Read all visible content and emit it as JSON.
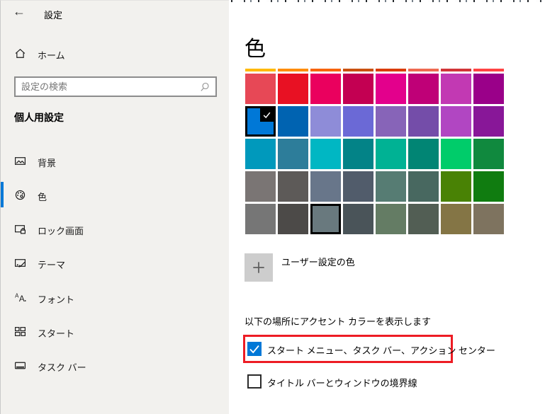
{
  "window": {
    "title": "設定",
    "back_icon": "←"
  },
  "sidebar": {
    "home": {
      "label": "ホーム",
      "icon": "home-icon"
    },
    "search": {
      "placeholder": "設定の検索",
      "icon": "search-icon"
    },
    "section_title": "個人用設定",
    "items": [
      {
        "label": "背景",
        "icon": "picture-icon",
        "selected": false
      },
      {
        "label": "色",
        "icon": "palette-icon",
        "selected": true
      },
      {
        "label": "ロック画面",
        "icon": "lock-screen-icon",
        "selected": false
      },
      {
        "label": "テーマ",
        "icon": "theme-icon",
        "selected": false
      },
      {
        "label": "フォント",
        "icon": "fonts-icon",
        "selected": false
      },
      {
        "label": "スタート",
        "icon": "start-tiles-icon",
        "selected": false
      },
      {
        "label": "タスク バー",
        "icon": "taskbar-icon",
        "selected": false
      }
    ]
  },
  "main": {
    "page_title": "色",
    "palette": {
      "colors": [
        "#ffb900",
        "#ff8c00",
        "#f7630c",
        "#ca5010",
        "#da3b01",
        "#ef6950",
        "#d13438",
        "#ff4343",
        "#e74856",
        "#e81123",
        "#ea005e",
        "#c30052",
        "#e3008c",
        "#bf0077",
        "#c239b3",
        "#9a0089",
        "#0078d7",
        "#0063b1",
        "#8e8cd8",
        "#6b69d6",
        "#8764b8",
        "#744da9",
        "#b146c2",
        "#881798",
        "#0099bc",
        "#2d7d9a",
        "#00b7c3",
        "#038387",
        "#00b294",
        "#018574",
        "#00cc6a",
        "#10893e",
        "#7a7574",
        "#5d5a58",
        "#68768a",
        "#515c6b",
        "#567c73",
        "#486860",
        "#498205",
        "#107c10",
        "#767676",
        "#4c4a48",
        "#69797e",
        "#4a5459",
        "#647c64",
        "#525e54",
        "#847545",
        "#7e735f"
      ],
      "selected_index": 16,
      "selected_color": "#0078d7",
      "outlined_index": 42,
      "outlined_color": "#69797e",
      "check_icon": "checkmark-icon"
    },
    "custom_color": {
      "label": "ユーザー設定の色",
      "plus_icon": "+"
    },
    "accent_section": {
      "heading": "以下の場所にアクセント カラーを表示します",
      "checkboxes": [
        {
          "label": "スタート メニュー、タスク バー、アクション センター",
          "checked": true,
          "highlighted": true
        },
        {
          "label": "タイトル バーとウィンドウの境界線",
          "checked": false,
          "highlighted": false
        }
      ]
    }
  },
  "colors": {
    "accent": "#0078d7",
    "annotation_red": "#ed1c24",
    "sidebar_bg": "#f2f1ee"
  }
}
